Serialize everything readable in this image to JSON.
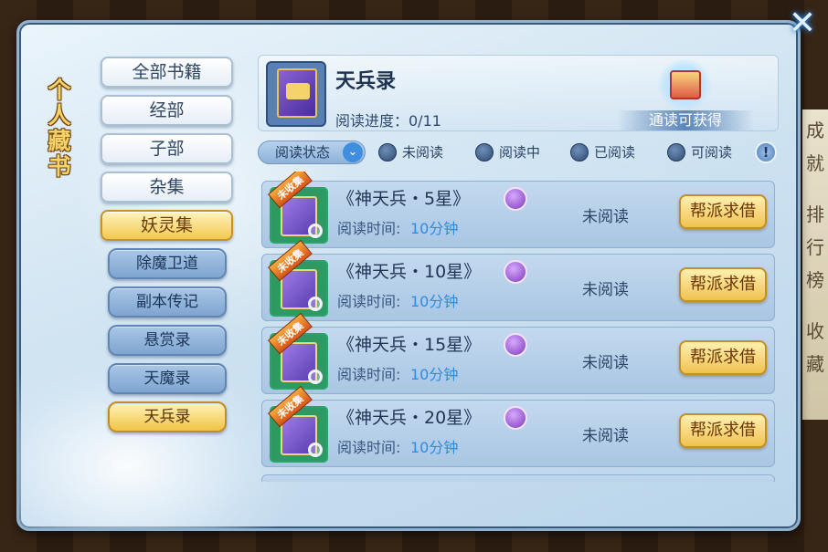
{
  "panel": {
    "title": "个人藏书",
    "title_chars": [
      "个",
      "人",
      "藏",
      "书"
    ],
    "close_icon": "close-icon"
  },
  "background": {
    "right_chars": [
      "成",
      "就",
      "排",
      "行",
      "榜",
      "收",
      "藏"
    ]
  },
  "nav": {
    "main": [
      {
        "label": "全部书籍",
        "active": false
      },
      {
        "label": "经部",
        "active": false
      },
      {
        "label": "子部",
        "active": false
      },
      {
        "label": "杂集",
        "active": false
      },
      {
        "label": "妖灵集",
        "active": true
      }
    ],
    "sub": [
      {
        "label": "除魔卫道",
        "active": false
      },
      {
        "label": "副本传记",
        "active": false
      },
      {
        "label": "悬赏录",
        "active": false
      },
      {
        "label": "天魔录",
        "active": false
      },
      {
        "label": "天兵录",
        "active": true
      }
    ]
  },
  "header": {
    "book_title": "天兵录",
    "progress_text": "阅读进度：0/11",
    "progress_value": 0,
    "progress_total": 11,
    "reward_label": "通读可获得"
  },
  "filter": {
    "label": "阅读状态",
    "options": [
      "未阅读",
      "阅读中",
      "已阅读",
      "可阅读"
    ],
    "info": "!"
  },
  "list": {
    "time_label": "阅读时间:",
    "ribbon": "未收集",
    "rows": [
      {
        "name": "《神天兵・5星》",
        "time": "10分钟",
        "status": "未阅读",
        "button": "帮派求借"
      },
      {
        "name": "《神天兵・10星》",
        "time": "10分钟",
        "status": "未阅读",
        "button": "帮派求借"
      },
      {
        "name": "《神天兵・15星》",
        "time": "10分钟",
        "status": "未阅读",
        "button": "帮派求借"
      },
      {
        "name": "《神天兵・20星》",
        "time": "10分钟",
        "status": "未阅读",
        "button": "帮派求借"
      }
    ]
  },
  "colors": {
    "accent_gold": "#f0c250",
    "time_blue": "#2d8be0",
    "panel_blue": "#cfe3f1"
  }
}
